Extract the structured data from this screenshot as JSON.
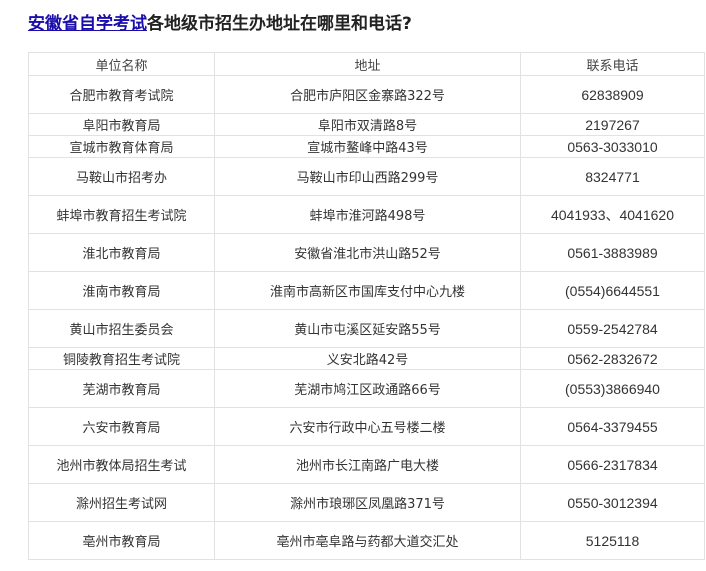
{
  "title": {
    "link_text": "安徽省自学考试",
    "rest": "各地级市招生办地址在哪里和电话?"
  },
  "table": {
    "headers": [
      "单位名称",
      "地址",
      "联系电话"
    ],
    "rows": [
      [
        "合肥市教育考试院",
        "合肥市庐阳区金寨路322号",
        "62838909"
      ],
      [
        "阜阳市教育局",
        "阜阳市双清路8号",
        "2197267"
      ],
      [
        "宣城市教育体育局",
        "宣城市鳌峰中路43号",
        "0563-3033010"
      ],
      [
        "马鞍山市招考办",
        "马鞍山市印山西路299号",
        "8324771"
      ],
      [
        "蚌埠市教育招生考试院",
        "蚌埠市淮河路498号",
        "4041933、4041620"
      ],
      [
        "淮北市教育局",
        "安徽省淮北市洪山路52号",
        "0561-3883989"
      ],
      [
        "淮南市教育局",
        "淮南市高新区市国库支付中心九楼",
        "(0554)6644551"
      ],
      [
        "黄山市招生委员会",
        "黄山市屯溪区延安路55号",
        "0559-2542784"
      ],
      [
        "铜陵教育招生考试院",
        "义安北路42号",
        "0562-2832672"
      ],
      [
        "芜湖市教育局",
        "芜湖市鸠江区政通路66号",
        "(0553)3866940"
      ],
      [
        "六安市教育局",
        "六安市行政中心五号楼二楼",
        "0564-3379455"
      ],
      [
        "池州市教体局招生考试",
        "池州市长江南路广电大楼",
        "0566-2317834"
      ],
      [
        "滁州招生考试网",
        "滁州市琅琊区凤凰路371号",
        "0550-3012394"
      ],
      [
        "亳州市教育局",
        "亳州市亳阜路与药都大道交汇处",
        "5125118"
      ]
    ]
  }
}
